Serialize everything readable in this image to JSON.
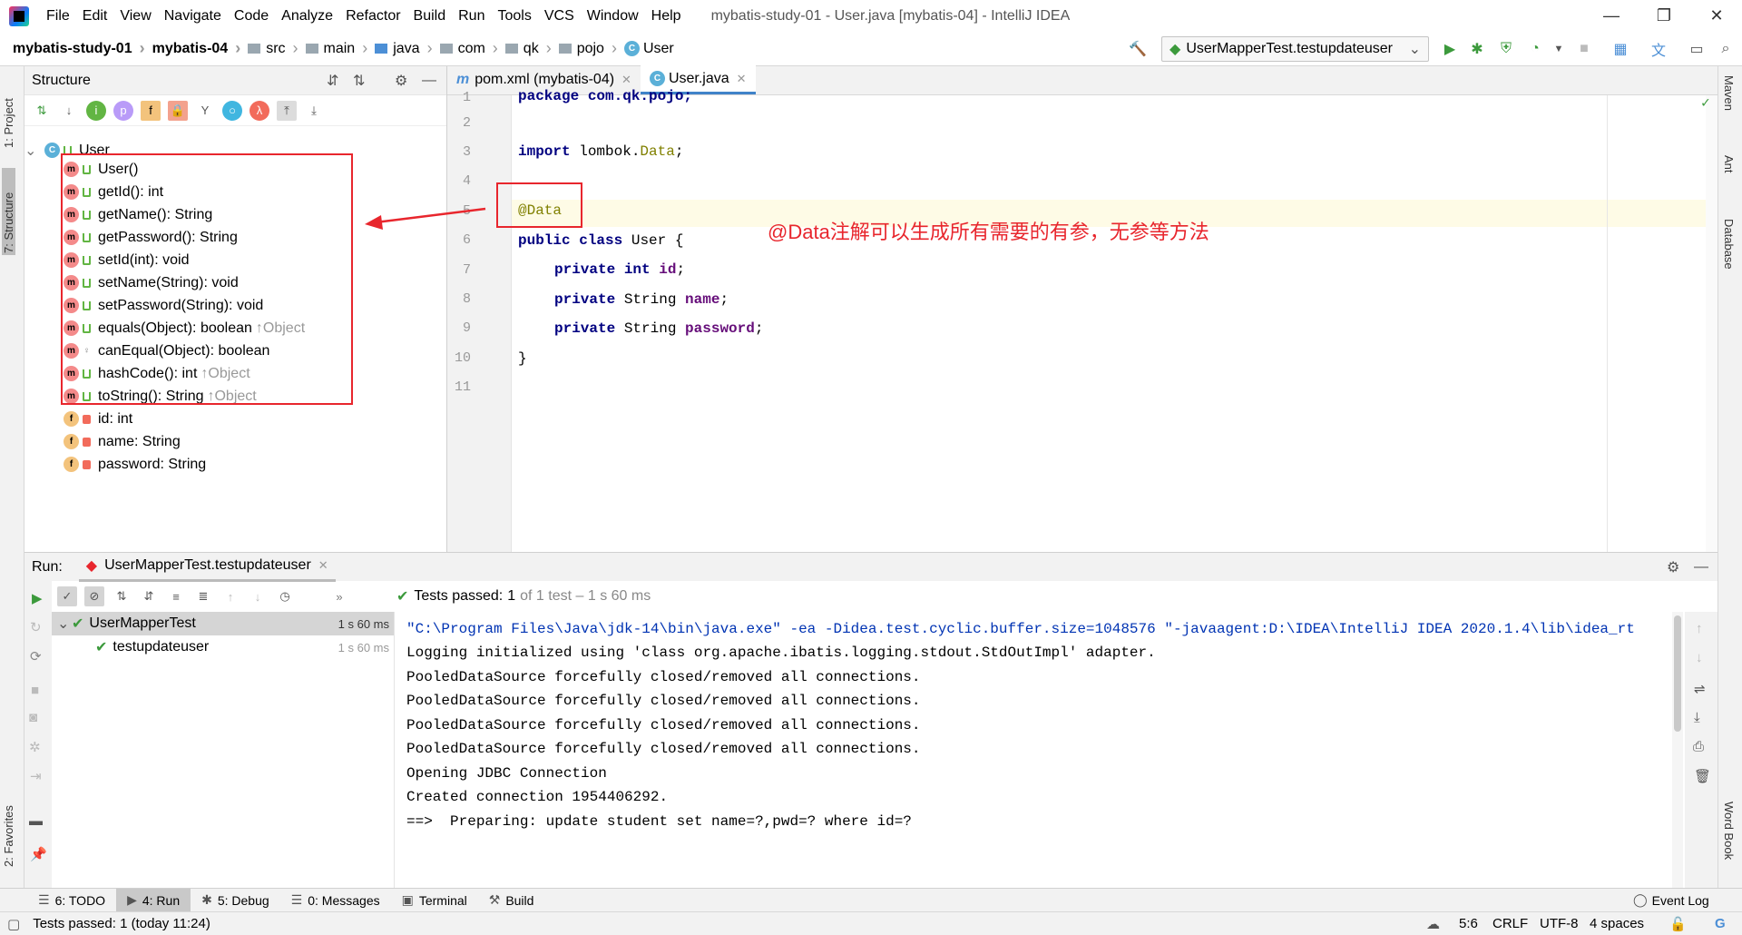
{
  "menu": {
    "items": [
      "File",
      "Edit",
      "View",
      "Navigate",
      "Code",
      "Analyze",
      "Refactor",
      "Build",
      "Run",
      "Tools",
      "VCS",
      "Window",
      "Help"
    ],
    "window_title": "mybatis-study-01 - User.java [mybatis-04] - IntelliJ IDEA"
  },
  "breadcrumbs": [
    "mybatis-study-01",
    "mybatis-04",
    "src",
    "main",
    "java",
    "com",
    "qk",
    "pojo",
    "User"
  ],
  "run_config": "UserMapperTest.testupdateuser",
  "left_stripe": {
    "project": "1: Project",
    "structure": "7: Structure",
    "favorites": "2: Favorites"
  },
  "right_stripe": {
    "maven": "Maven",
    "ant": "Ant",
    "database": "Database",
    "wordbook": "Word Book"
  },
  "structure": {
    "title": "Structure",
    "root": "User",
    "methods": [
      {
        "name": "User()",
        "inherit": ""
      },
      {
        "name": "getId(): int",
        "inherit": ""
      },
      {
        "name": "getName(): String",
        "inherit": ""
      },
      {
        "name": "getPassword(): String",
        "inherit": ""
      },
      {
        "name": "setId(int): void",
        "inherit": ""
      },
      {
        "name": "setName(String): void",
        "inherit": ""
      },
      {
        "name": "setPassword(String): void",
        "inherit": ""
      },
      {
        "name": "equals(Object): boolean",
        "inherit": "↑Object"
      },
      {
        "name": "canEqual(Object): boolean",
        "inherit": ""
      },
      {
        "name": "hashCode(): int",
        "inherit": "↑Object"
      },
      {
        "name": "toString(): String",
        "inherit": "↑Object"
      }
    ],
    "fields": [
      "id: int",
      "name: String",
      "password: String"
    ]
  },
  "editor": {
    "tabs": [
      {
        "label": "pom.xml (mybatis-04)",
        "icon": "m"
      },
      {
        "label": "User.java",
        "icon": "C"
      }
    ],
    "line_numbers": [
      "1",
      "2",
      "3",
      "4",
      "5",
      "6",
      "7",
      "8",
      "9",
      "10",
      "11"
    ],
    "code": {
      "l1": "package com.qk.pojo;",
      "l3_kw": "import",
      "l3_rest": " lombok.",
      "l3_cls": "Data",
      "l3_end": ";",
      "l5": "@Data",
      "l6_kw1": "public",
      "l6_kw2": "class",
      "l6_rest": " User {",
      "l7_kw": "private",
      "l7_type": "int",
      "l7_field": "id",
      "l8_kw": "private",
      "l8_type": " String ",
      "l8_field": "name",
      "l9_kw": "private",
      "l9_type": " String ",
      "l9_field": "password",
      "l10": "}"
    }
  },
  "annotation_note": "@Data注解可以生成所有需要的有参，无参等方法",
  "run": {
    "label": "Run:",
    "tab": "UserMapperTest.testupdateuser",
    "status_prefix": "Tests passed:",
    "status_count": "1",
    "status_rest": "of 1 test – 1 s 60 ms",
    "tests": [
      {
        "name": "UserMapperTest",
        "time": "1 s 60 ms"
      },
      {
        "name": "testupdateuser",
        "time": "1 s 60 ms"
      }
    ],
    "console": [
      "\"C:\\Program Files\\Java\\jdk-14\\bin\\java.exe\" -ea -Didea.test.cyclic.buffer.size=1048576 \"-javaagent:D:\\IDEA\\IntelliJ IDEA 2020.1.4\\lib\\idea_rt",
      "Logging initialized using 'class org.apache.ibatis.logging.stdout.StdOutImpl' adapter.",
      "PooledDataSource forcefully closed/removed all connections.",
      "PooledDataSource forcefully closed/removed all connections.",
      "PooledDataSource forcefully closed/removed all connections.",
      "PooledDataSource forcefully closed/removed all connections.",
      "Opening JDBC Connection",
      "Created connection 1954406292.",
      "==>  Preparing: update student set name=?,pwd=? where id=?"
    ]
  },
  "bottom_tabs": [
    "6: TODO",
    "4: Run",
    "5: Debug",
    "0: Messages",
    "Terminal",
    "Build"
  ],
  "event_log": "Event Log",
  "statusbar": {
    "message": "Tests passed: 1 (today 11:24)",
    "position": "5:6",
    "line_sep": "CRLF",
    "encoding": "UTF-8",
    "indent": "4 spaces"
  },
  "colors": {
    "annotation_red": "#e8262d",
    "keyword": "#000080",
    "field": "#660e7a",
    "annotation": "#808000",
    "passed_green": "#3c9a3c"
  }
}
